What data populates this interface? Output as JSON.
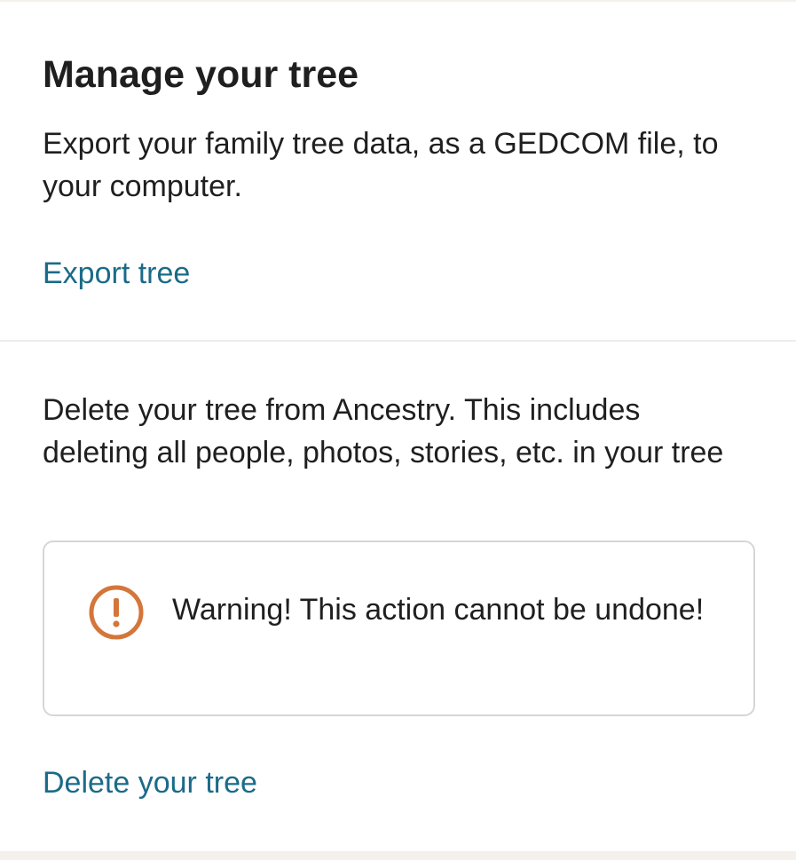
{
  "manage": {
    "title": "Manage your tree",
    "export_description": "Export your family tree data, as a GEDCOM file, to your computer.",
    "export_link": "Export tree",
    "delete_description": "Delete your tree from Ancestry. This includes deleting all people, photos, stories, etc. in your tree",
    "warning": {
      "icon": "exclamation-circle-icon",
      "text": "Warning! This action cannot be undone!"
    },
    "delete_link": "Delete your tree"
  },
  "colors": {
    "link": "#1b6b88",
    "warning_icon": "#d4763b",
    "text": "#1f1f1f",
    "border": "#d6d6d6",
    "background": "#f4f1ed"
  }
}
